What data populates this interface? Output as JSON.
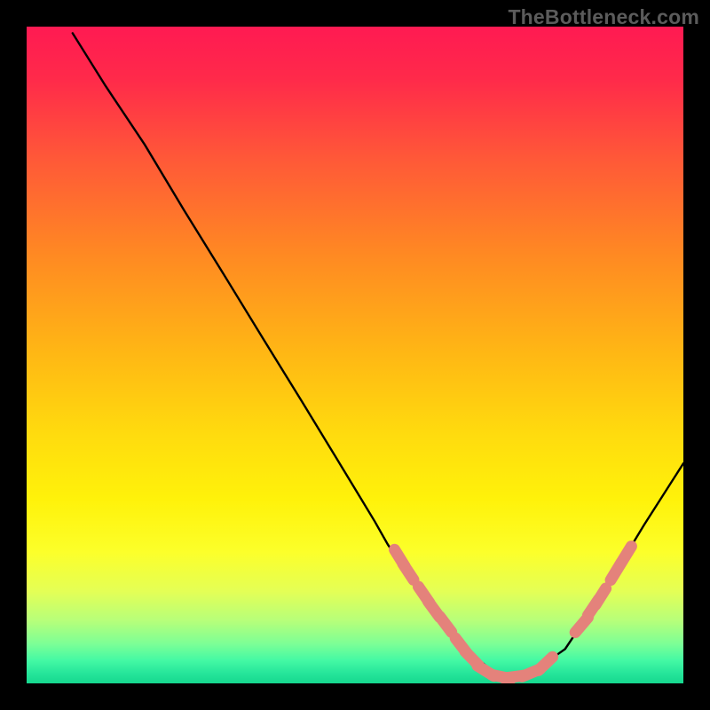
{
  "watermark": "TheBottleneck.com",
  "colors": {
    "frame_bg": "#000000",
    "curve": "#000000",
    "marker": "#e4827b",
    "gradient_stops": [
      {
        "offset": 0.0,
        "color": "#ff1a52"
      },
      {
        "offset": 0.08,
        "color": "#ff2a4a"
      },
      {
        "offset": 0.2,
        "color": "#ff5838"
      },
      {
        "offset": 0.35,
        "color": "#ff8a22"
      },
      {
        "offset": 0.5,
        "color": "#ffb814"
      },
      {
        "offset": 0.62,
        "color": "#ffdb0e"
      },
      {
        "offset": 0.72,
        "color": "#fff20a"
      },
      {
        "offset": 0.8,
        "color": "#fcff2a"
      },
      {
        "offset": 0.86,
        "color": "#e4ff56"
      },
      {
        "offset": 0.905,
        "color": "#b6ff7a"
      },
      {
        "offset": 0.94,
        "color": "#7cff96"
      },
      {
        "offset": 0.965,
        "color": "#44f9a4"
      },
      {
        "offset": 0.985,
        "color": "#25e59a"
      },
      {
        "offset": 1.0,
        "color": "#16d88f"
      }
    ]
  },
  "chart_data": {
    "type": "line",
    "title": "",
    "xlabel": "",
    "ylabel": "",
    "xlim": [
      0,
      100
    ],
    "ylim": [
      0,
      100
    ],
    "grid": false,
    "legend": false,
    "series": [
      {
        "name": "bottleneck-curve",
        "x": [
          7,
          12,
          18,
          24,
          30,
          36,
          42,
          47,
          50,
          53,
          55,
          57,
          59,
          62,
          65,
          68,
          72,
          76,
          82,
          88,
          94,
          100
        ],
        "y": [
          99,
          91,
          82,
          72,
          62.3,
          52.5,
          42.79,
          34.57,
          29.63,
          24.67,
          21.14,
          18.2,
          15.54,
          11.55,
          7.54,
          4.27,
          1,
          1,
          5.24,
          14.2,
          24.1,
          33.5
        ]
      }
    ],
    "markers": {
      "name": "highlighted-points",
      "points": [
        {
          "x": 56.8,
          "y": 19.1
        },
        {
          "x": 58.1,
          "y": 17.0
        },
        {
          "x": 60.5,
          "y": 13.5
        },
        {
          "x": 62.0,
          "y": 11.3
        },
        {
          "x": 63.8,
          "y": 9.0
        },
        {
          "x": 66.2,
          "y": 5.7
        },
        {
          "x": 67.8,
          "y": 3.8
        },
        {
          "x": 69.9,
          "y": 1.9
        },
        {
          "x": 72.3,
          "y": 1.0
        },
        {
          "x": 74.2,
          "y": 1.0
        },
        {
          "x": 76.8,
          "y": 1.6
        },
        {
          "x": 79.0,
          "y": 3.0
        },
        {
          "x": 84.5,
          "y": 8.9
        },
        {
          "x": 86.3,
          "y": 11.6
        },
        {
          "x": 87.4,
          "y": 13.2
        },
        {
          "x": 89.7,
          "y": 17.0
        },
        {
          "x": 91.3,
          "y": 19.6
        }
      ]
    }
  }
}
